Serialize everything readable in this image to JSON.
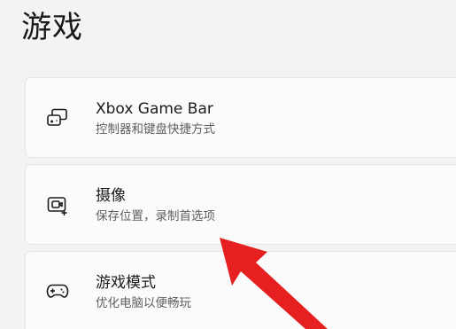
{
  "page": {
    "title": "游戏"
  },
  "items": [
    {
      "icon": "xbox-game-bar-icon",
      "label": "Xbox Game Bar",
      "description": "控制器和键盘快捷方式"
    },
    {
      "icon": "capture-camera-icon",
      "label": "摄像",
      "description": "保存位置，录制首选项"
    },
    {
      "icon": "gamepad-icon",
      "label": "游戏模式",
      "description": "优化电脑以便畅玩"
    }
  ],
  "annotation": {
    "arrow_color": "#e62020"
  }
}
